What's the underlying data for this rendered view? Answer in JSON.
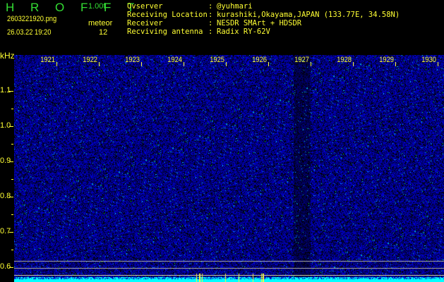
{
  "header": {
    "app_title": "H R O F F T",
    "version": "1.00f",
    "filename": "2603221920.png",
    "datetime": "26.03.22 19:20",
    "meteor_label": "meteor",
    "meteor_count": "12"
  },
  "info": [
    {
      "label": "Ovserver",
      "value": "@yuhmari"
    },
    {
      "label": "Receiving Location",
      "value": "kurashiki,Okayama,JAPAN (133.77E, 34.58N)"
    },
    {
      "label": "Receiver",
      "value": "NESDR SMArt + HDSDR"
    },
    {
      "label": "Recviving antenna",
      "value": "Radix RY-62V"
    }
  ],
  "axis": {
    "unit": "kHz",
    "y_labels": [
      "1.1",
      "1.0",
      "0.9",
      "0.8",
      "0.7",
      "0.6"
    ],
    "time_labels": [
      "1921",
      "1922",
      "1923",
      "1924",
      "1925",
      "1926",
      "1927",
      "1928",
      "1929",
      "1930"
    ]
  },
  "colors": {
    "text": "#ffff33",
    "title": "#33dd33",
    "noise": "#1a1ad0",
    "signal": "#00ffff"
  }
}
